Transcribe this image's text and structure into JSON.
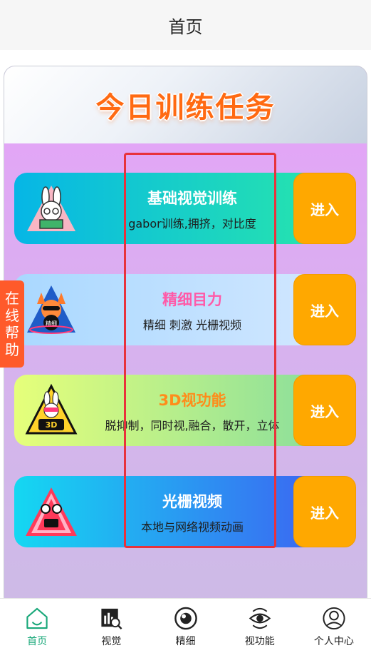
{
  "header": {
    "title": "首页"
  },
  "card": {
    "title": "今日训练任务"
  },
  "tasks": [
    {
      "title": "基础视觉训练",
      "desc": "gabor训练,拥挤，对比度",
      "button": "进入",
      "icon": "rabbit-reading-icon",
      "title_color": "#ffffff",
      "bg": [
        "#06b6e6",
        "#25e2b0"
      ]
    },
    {
      "title": "精细目力",
      "desc": "精细 刺激 光栅视频",
      "button": "进入",
      "icon": "fox-detail-icon",
      "title_color": "#ff5aa8",
      "bg": [
        "#a9d8ff",
        "#cfe6ff"
      ]
    },
    {
      "title": "3D视功能",
      "desc": "脱抑制，同时视,融合，散开，立体",
      "button": "进入",
      "icon": "rabbit-3d-icon",
      "title_color": "#ff8c1a",
      "bg": [
        "#e6ff7a",
        "#8ee09a"
      ]
    },
    {
      "title": "光栅视频",
      "desc": "本地与网络视频动画",
      "button": "进入",
      "icon": "grating-video-icon",
      "title_color": "#ffffff",
      "bg": [
        "#14d8f2",
        "#3a6af2"
      ]
    }
  ],
  "help": {
    "label": "在线帮助"
  },
  "tabbar": {
    "items": [
      {
        "label": "首页",
        "icon": "home-icon",
        "active": true
      },
      {
        "label": "视觉",
        "icon": "vision-chart-icon",
        "active": false
      },
      {
        "label": "精细",
        "icon": "eye-circle-icon",
        "active": false
      },
      {
        "label": "视功能",
        "icon": "eye-rotate-icon",
        "active": false
      },
      {
        "label": "个人中心",
        "icon": "user-icon",
        "active": false
      }
    ]
  },
  "colors": {
    "accent": "#1aa87a",
    "button": "#ffa800",
    "help": "#ff5a2a",
    "title": "#ff6a12"
  }
}
